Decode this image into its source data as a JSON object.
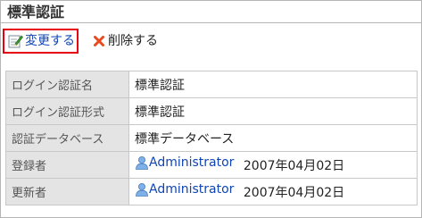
{
  "page": {
    "title": "標準認証"
  },
  "toolbar": {
    "edit_label": "変更する",
    "delete_label": "削除する"
  },
  "details": {
    "rows": [
      {
        "label": "ログイン認証名",
        "value": "標準認証"
      },
      {
        "label": "ログイン認証形式",
        "value": "標準認証"
      },
      {
        "label": "認証データベース",
        "value": "標準データベース"
      },
      {
        "label": "登録者",
        "user": "Administrator",
        "date": "2007年04月02日"
      },
      {
        "label": "更新者",
        "user": "Administrator",
        "date": "2007年04月02日"
      }
    ]
  },
  "colors": {
    "link": "#0f45b4",
    "highlight_border": "#e60012",
    "label_background": "#e4e4e4",
    "delete_icon": "#e8491f"
  },
  "icons": {
    "edit": "edit-icon",
    "delete": "delete-x-icon",
    "user": "user-icon"
  }
}
